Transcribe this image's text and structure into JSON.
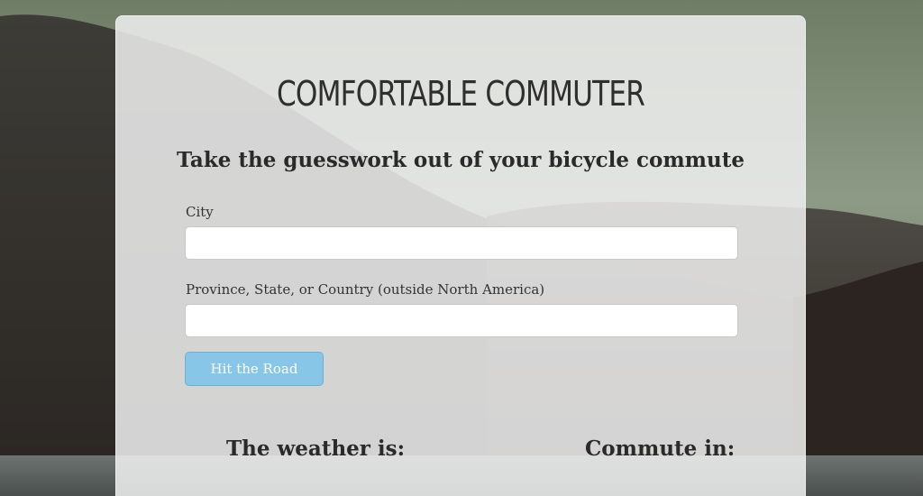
{
  "app": {
    "title": "COMFORTABLE COMMUTER",
    "tagline": "Take the guesswork out of your bicycle commute"
  },
  "form": {
    "city_label": "City",
    "city_value": "",
    "region_label": "Province, State, or Country (outside North America)",
    "region_value": "",
    "submit_label": "Hit the Road"
  },
  "results": {
    "weather_heading": "The weather is:",
    "commute_heading": "Commute in:"
  },
  "colors": {
    "button": "#87c6e6",
    "card": "#f0f0f0",
    "text": "#2a2a2a"
  }
}
